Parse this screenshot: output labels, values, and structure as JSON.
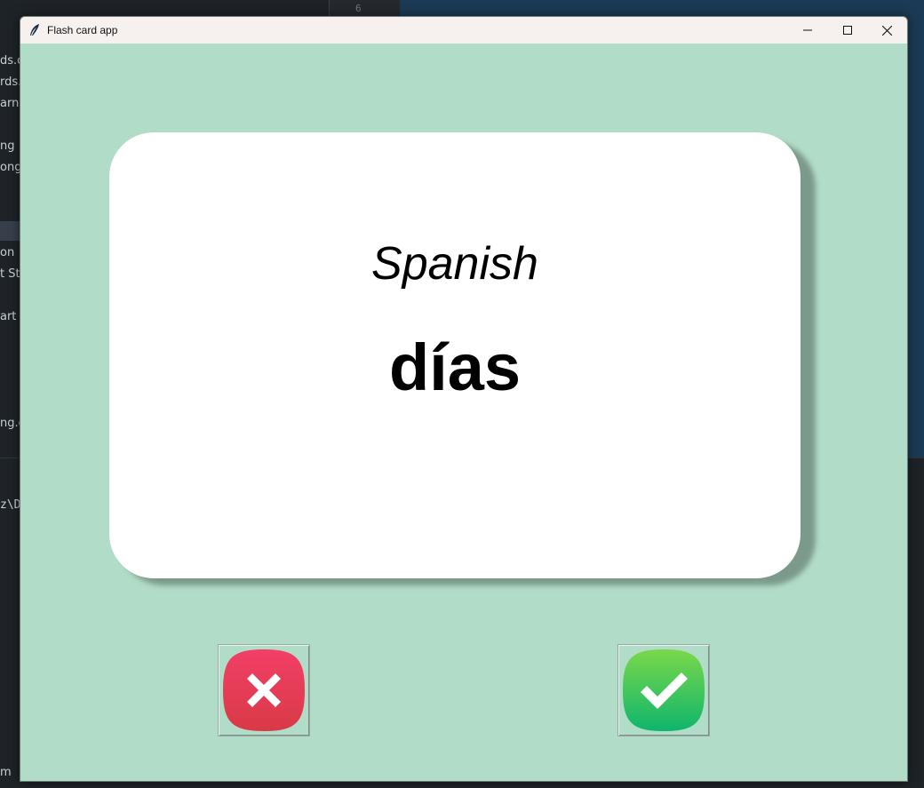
{
  "window": {
    "title": "Flash card app",
    "controls": [
      "minimize",
      "maximize",
      "close"
    ]
  },
  "card": {
    "language": "Spanish",
    "word": "días"
  },
  "buttons": {
    "wrong_icon": "x-mark-icon",
    "right_icon": "check-mark-icon"
  },
  "colors": {
    "background": "#b1dcc7",
    "card": "#ffffff",
    "wrong_button": "#e53d5a",
    "right_button": "#2ec56a"
  },
  "background_app": {
    "line_number": "6",
    "fragments": [
      "ds.c",
      "rds.",
      "arn",
      "ng",
      "ong",
      "on",
      "t St",
      "art",
      "ng.g",
      "z\\D",
      "m"
    ]
  }
}
